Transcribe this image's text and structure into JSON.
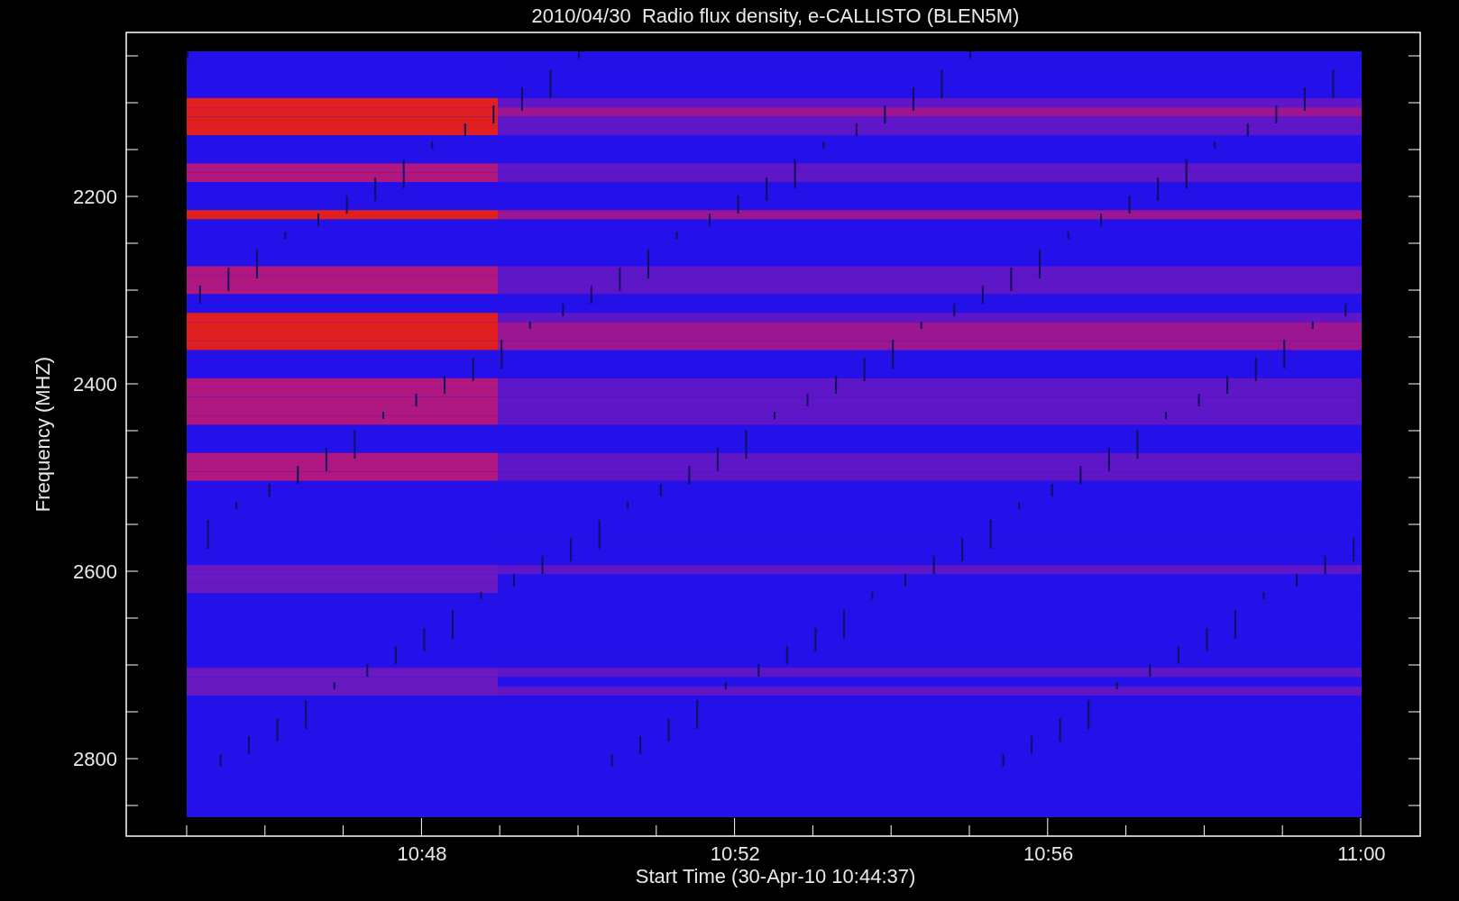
{
  "title": "2010/04/30  Radio flux density, e-CALLISTO (BLEN5M)",
  "y_axis": {
    "label": "Frequency (MHZ)",
    "tick_labels": [
      "2200",
      "2400",
      "2600",
      "2800"
    ]
  },
  "x_axis": {
    "label": "Start Time (30-Apr-10 10:44:37)",
    "tick_labels": [
      "10:48",
      "10:52",
      "10:56",
      "11:00"
    ]
  }
}
